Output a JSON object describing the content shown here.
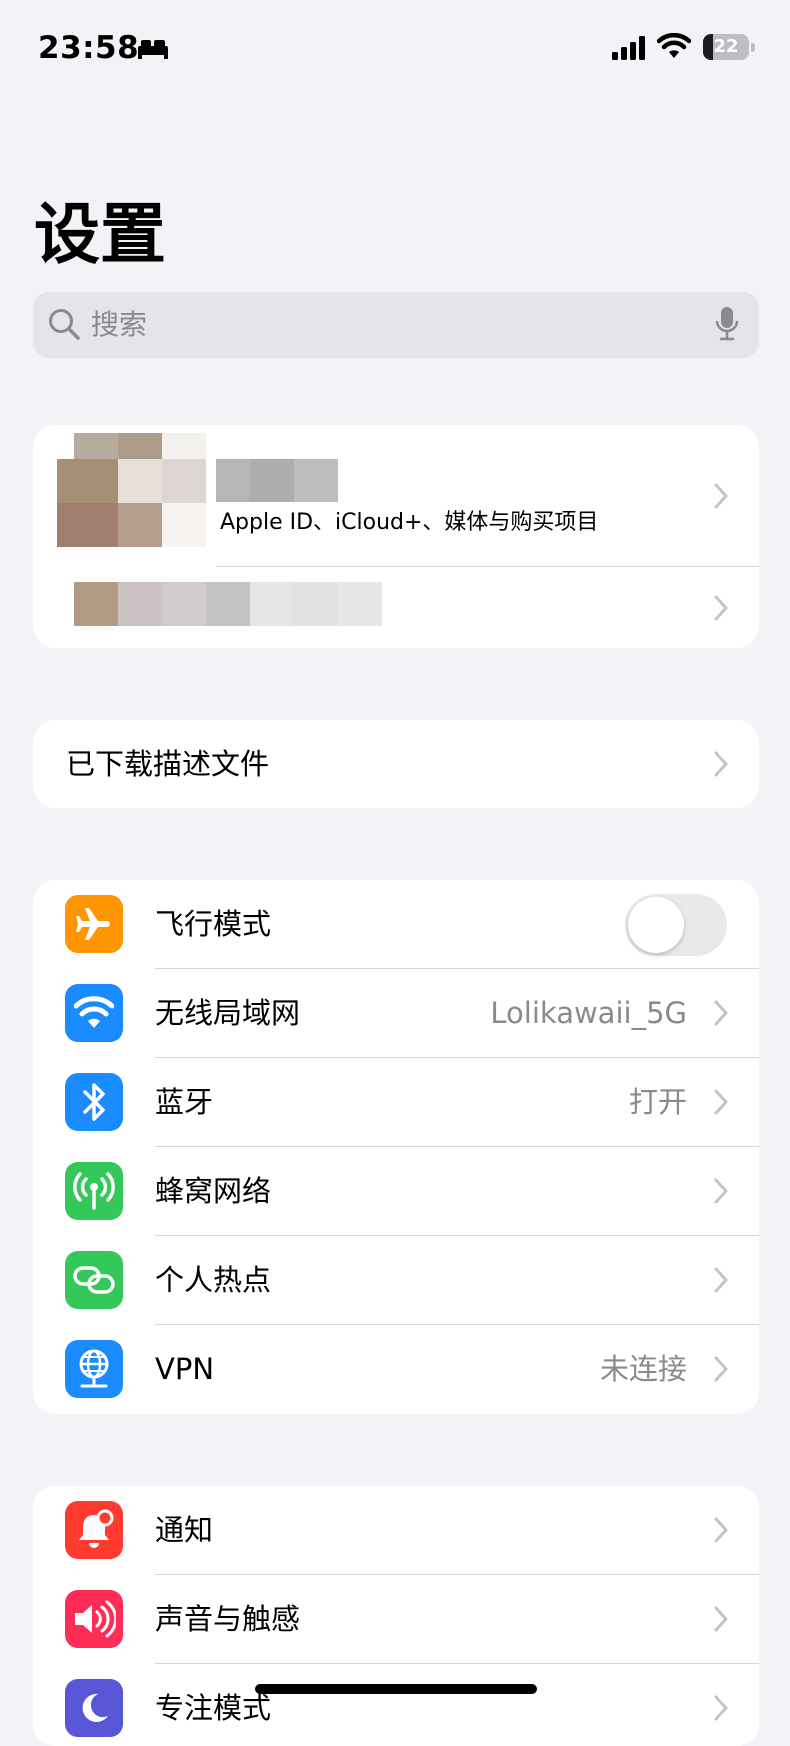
{
  "status_bar": {
    "time": "23:58",
    "battery_level": "22",
    "battery_fraction": 0.22
  },
  "title": "设置",
  "search": {
    "placeholder": "搜索"
  },
  "profile": {
    "subtitle": "Apple ID、iCloud+、媒体与购买项目"
  },
  "profiles_section": {
    "label": "已下载描述文件"
  },
  "network_section": {
    "items": [
      {
        "label": "飞行模式",
        "value": "",
        "icon": "airplane-icon",
        "color": "#ff9500",
        "toggle": false
      },
      {
        "label": "无线局域网",
        "value": "Lolikawaii_5G",
        "icon": "wifi-icon",
        "color": "#1a8cff"
      },
      {
        "label": "蓝牙",
        "value": "打开",
        "icon": "bluetooth-icon",
        "color": "#1a8cff"
      },
      {
        "label": "蜂窝网络",
        "value": "",
        "icon": "cellular-icon",
        "color": "#34c759"
      },
      {
        "label": "个人热点",
        "value": "",
        "icon": "hotspot-icon",
        "color": "#34c759"
      },
      {
        "label": "VPN",
        "value": "未连接",
        "icon": "vpn-globe-icon",
        "color": "#1a8cff"
      }
    ]
  },
  "notify_section": {
    "items": [
      {
        "label": "通知",
        "icon": "notification-bell-icon",
        "color": "#ff3b30"
      },
      {
        "label": "声音与触感",
        "icon": "speaker-icon",
        "color": "#ff2d55"
      },
      {
        "label": "专注模式",
        "icon": "moon-icon",
        "color": "#5856d6"
      }
    ]
  }
}
